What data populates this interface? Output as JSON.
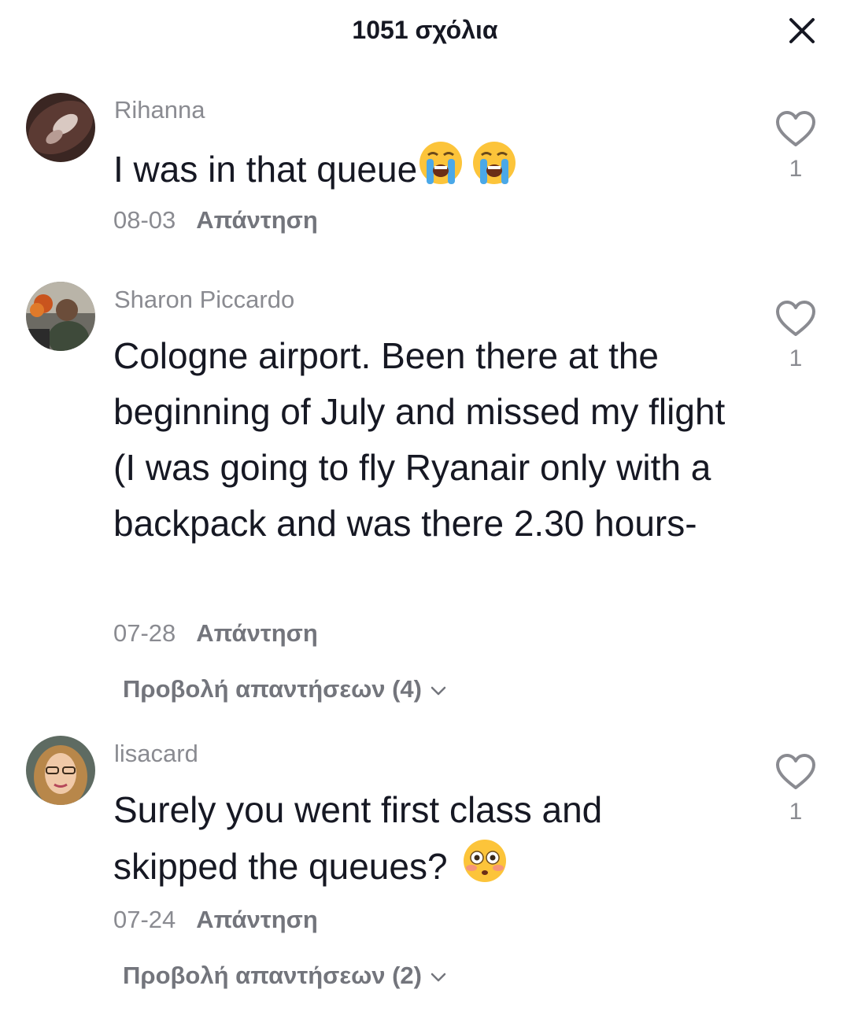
{
  "header": {
    "title": "1051 σχόλια",
    "close_icon": "close-icon"
  },
  "comments": [
    {
      "username": "Rihanna",
      "text": "I was in that queue",
      "emojis": [
        "loudly-crying-face-icon",
        "loudly-crying-face-icon"
      ],
      "date": "08-03",
      "reply_label": "Απάντηση",
      "likes": "1"
    },
    {
      "username": "Sharon Piccardo",
      "text": "Cologne airport. Been there at the beginning of July and missed my flight (I was going to fly Ryanair only with a backpack and was there 2.30 hours-",
      "date": "07-28",
      "reply_label": "Απάντηση",
      "likes": "1",
      "view_replies": "Προβολή απαντήσεων (4)"
    },
    {
      "username": "lisacard",
      "text": "Surely you went first class and skipped the queues?",
      "emojis": [
        "flushed-face-icon"
      ],
      "date": "07-24",
      "reply_label": "Απάντηση",
      "likes": "1",
      "view_replies": "Προβολή απαντήσεων (2)"
    }
  ],
  "colors": {
    "primary_text": "#161823",
    "secondary_text": "#8a8b91",
    "reply_text": "#73757c",
    "background": "#ffffff"
  }
}
